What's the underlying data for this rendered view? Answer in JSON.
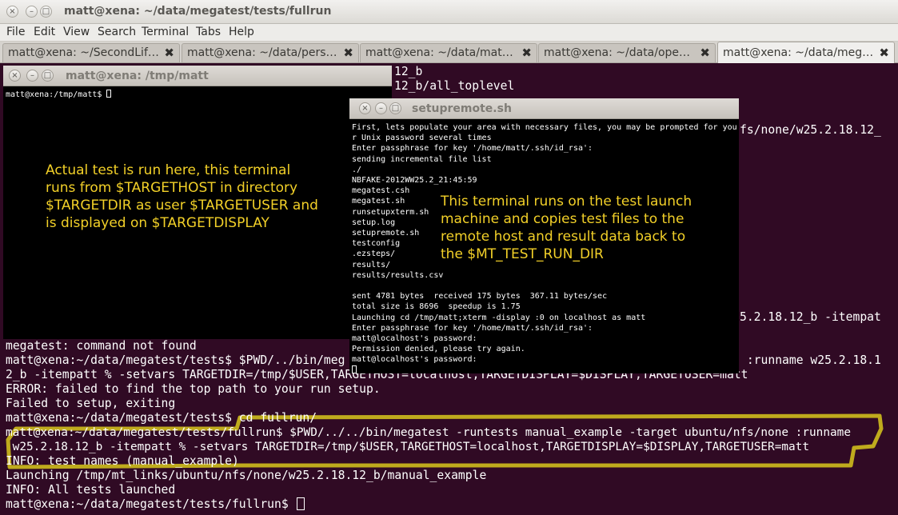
{
  "main_window": {
    "title": "matt@xena: ~/data/megatest/tests/fullrun",
    "window_buttons": [
      "×",
      "–",
      "□"
    ],
    "menu": [
      "File",
      "Edit",
      "View",
      "Search",
      "Terminal",
      "Tabs",
      "Help"
    ],
    "tabs": [
      {
        "label": "matt@xena: ~/SecondLif…",
        "close": "✖"
      },
      {
        "label": "matt@xena: ~/data/pers…",
        "close": "✖"
      },
      {
        "label": "matt@xena: ~/data/matt…",
        "close": "✖"
      },
      {
        "label": "matt@xena: ~/data/open…",
        "close": "✖"
      },
      {
        "label": "matt@xena: ~/data/mega…",
        "close": "✖"
      }
    ],
    "terminal_lines": [
      "12_b",
      "12_b/all_toplevel",
      "fs/none/w25.2.18.12_",
      "5.2.18.12_b -itempat",
      "megatest: command not found",
      "matt@xena:~/data/megatest/tests$ $PWD/../bin/meg",
      " :runname w25.2.18.1",
      "2_b -itempatt % -setvars TARGETDIR=/tmp/$USER,TARGETHOST=localhost,TARGETDISPLAY=$DISPLAY,TARGETUSER=matt",
      "ERROR: failed to find the top path to your run setup.",
      "Failed to setup, exiting",
      "matt@xena:~/data/megatest/tests$ cd fullrun/",
      "matt@xena:~/data/megatest/tests/fullrun$ $PWD/../../bin/megatest -runtests manual_example -target ubuntu/nfs/none :runname",
      " w25.2.18.12_b -itempatt % -setvars TARGETDIR=/tmp/$USER,TARGETHOST=localhost,TARGETDISPLAY=$DISPLAY,TARGETUSER=matt",
      "INFO: test names (manual_example)",
      "Launching /tmp/mt_links/ubuntu/nfs/none/w25.2.18.12_b/manual_example",
      "INFO: All tests launched",
      "matt@xena:~/data/megatest/tests/fullrun$ "
    ],
    "highlight_color": "#d8c81c"
  },
  "xterm_tmp": {
    "title": "matt@xena: /tmp/matt",
    "prompt": "matt@xena:/tmp/matt$ ",
    "annotation": "Actual test is run here, this terminal\nruns from $TARGETHOST in directory\n$TARGETDIR as user $TARGETUSER and\nis displayed on $TARGETDISPLAY"
  },
  "setup_window": {
    "title": "setupremote.sh",
    "lines": [
      "First, lets populate your area with necessary files, you may be prompted for you",
      "r Unix password several times",
      "Enter passphrase for key '/home/matt/.ssh/id_rsa':",
      "sending incremental file list",
      "./",
      "NBFAKE-2012WW25.2_21:45:59",
      "megatest.csh",
      "megatest.sh",
      "runsetupxterm.sh",
      "setup.log",
      "setupremote.sh",
      "testconfig",
      ".ezsteps/",
      "results/",
      "results/results.csv",
      "",
      "sent 4781 bytes  received 175 bytes  367.11 bytes/sec",
      "total size is 8696  speedup is 1.75",
      "Launching cd /tmp/matt;xterm -display :0 on localhost as matt",
      "Enter passphrase for key '/home/matt/.ssh/id_rsa':",
      "matt@localhost's password:",
      "Permission denied, please try again.",
      "matt@localhost's password:"
    ],
    "annotation": "This terminal runs on the test launch\nmachine and copies test files to the\nremote host and result data back to\nthe $MT_TEST_RUN_DIR"
  },
  "colors": {
    "terminal_bg": "#300a24",
    "annotation_text": "#f2d028",
    "xterm_bg": "#000000"
  }
}
